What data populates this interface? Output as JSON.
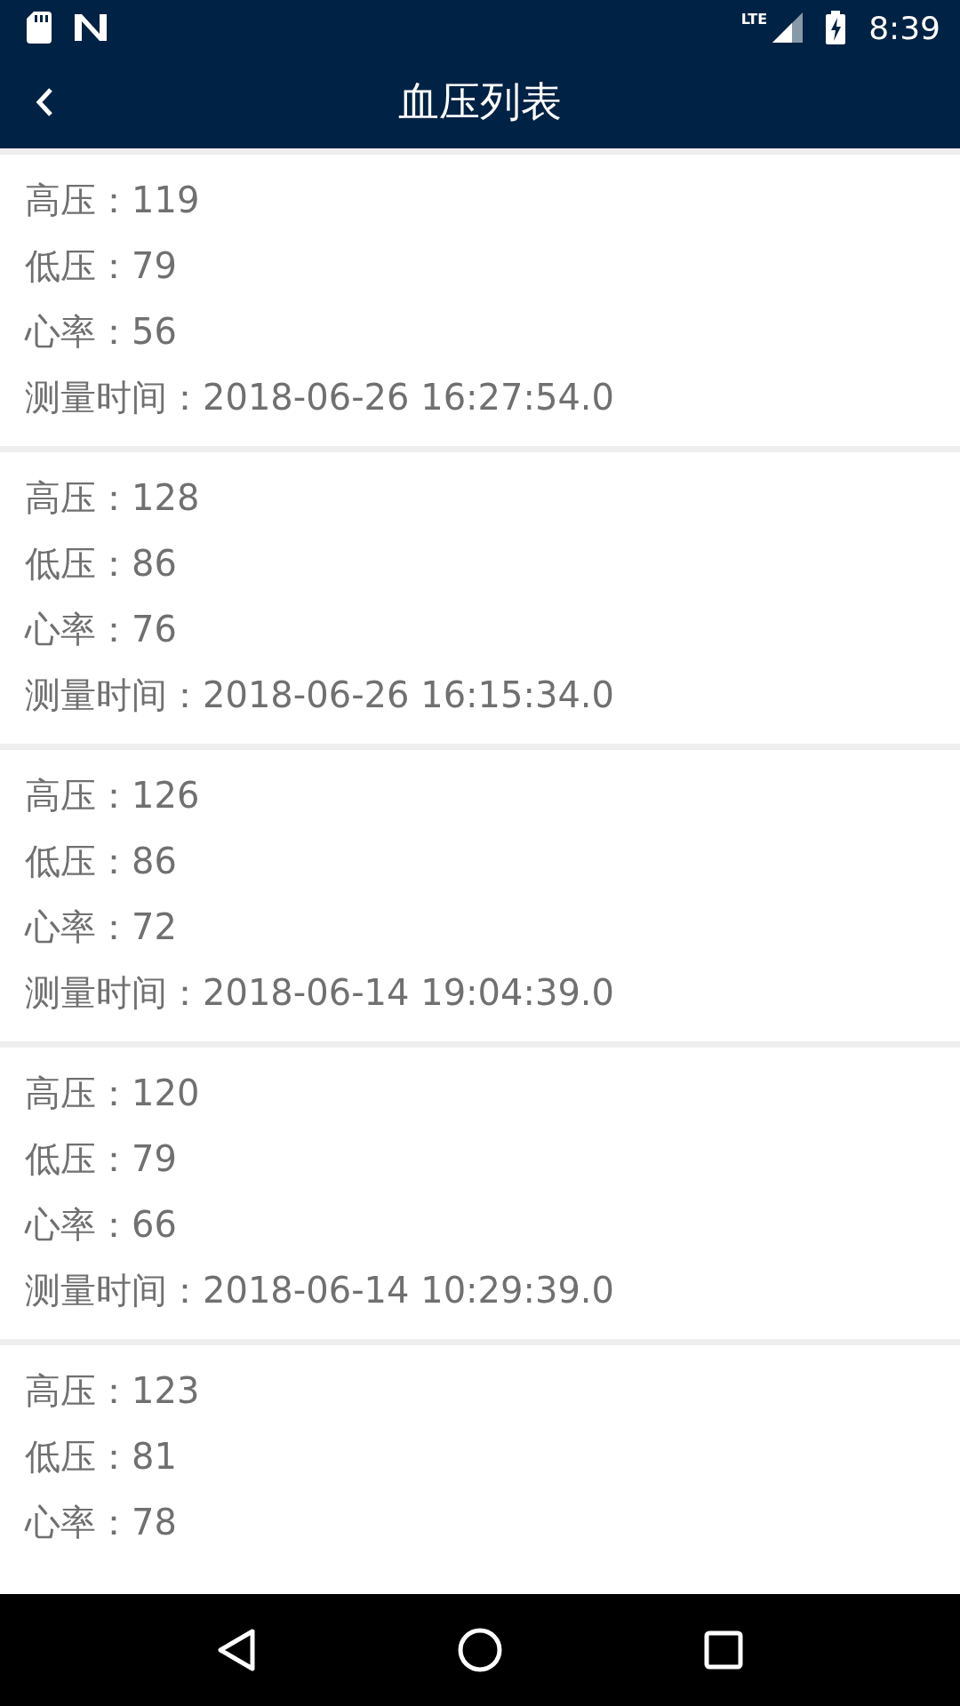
{
  "status_bar": {
    "network": "LTE",
    "time": "8:39"
  },
  "toolbar": {
    "title": "血压列表"
  },
  "records": [
    {
      "lines": [
        {
          "label": "高压：",
          "value": "119"
        },
        {
          "label": "低压：",
          "value": "79"
        },
        {
          "label": "心率：",
          "value": "56"
        },
        {
          "label": "测量时间：",
          "value": "2018-06-26 16:27:54.0"
        }
      ]
    },
    {
      "lines": [
        {
          "label": "高压：",
          "value": "128"
        },
        {
          "label": "低压：",
          "value": "86"
        },
        {
          "label": "心率：",
          "value": "76"
        },
        {
          "label": "测量时间：",
          "value": "2018-06-26 16:15:34.0"
        }
      ]
    },
    {
      "lines": [
        {
          "label": "高压：",
          "value": "126"
        },
        {
          "label": "低压：",
          "value": "86"
        },
        {
          "label": "心率：",
          "value": "72"
        },
        {
          "label": "测量时间：",
          "value": "2018-06-14 19:04:39.0"
        }
      ]
    },
    {
      "lines": [
        {
          "label": "高压：",
          "value": "120"
        },
        {
          "label": "低压：",
          "value": "79"
        },
        {
          "label": "心率：",
          "value": "66"
        },
        {
          "label": "测量时间：",
          "value": "2018-06-14 10:29:39.0"
        }
      ]
    },
    {
      "lines": [
        {
          "label": "高压：",
          "value": "123"
        },
        {
          "label": "低压：",
          "value": "81"
        },
        {
          "label": "心率：",
          "value": "78"
        }
      ]
    }
  ]
}
